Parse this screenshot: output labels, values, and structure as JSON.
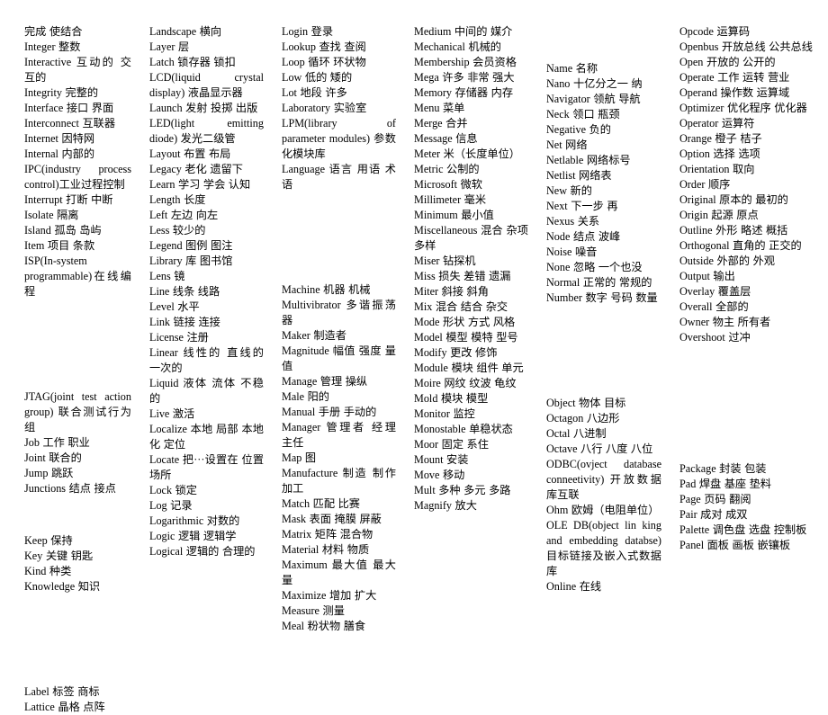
{
  "document": {
    "type": "bilingual-glossary",
    "page_background": "#ffffff",
    "text_color": "#000000",
    "column_count": 6
  },
  "columns": [
    {
      "name": "column-1",
      "entries": [
        {
          "text": "完成 使结合",
          "blank": false
        },
        {
          "text": "Integer 整数",
          "blank": false
        },
        {
          "text": "Interactive 互动的 交互的",
          "blank": false
        },
        {
          "text": "Integrity 完整的",
          "blank": false
        },
        {
          "text": "Interface 接口 界面",
          "blank": false
        },
        {
          "text": "Interconnect 互联器",
          "blank": false
        },
        {
          "text": "Internet 因特网",
          "blank": false
        },
        {
          "text": "Internal 内部的",
          "blank": false
        },
        {
          "text": "IPC(industry process control)工业过程控制",
          "blank": false
        },
        {
          "text": "Interrupt 打断 中断",
          "blank": false
        },
        {
          "text": "Isolate 隔离",
          "blank": false
        },
        {
          "text": "Island 孤岛 岛屿",
          "blank": false
        },
        {
          "text": "Item 项目 条款",
          "blank": false
        },
        {
          "text": "ISP(In-system programmable)在线编程",
          "blank": false
        },
        {
          "text": "",
          "blank": true
        },
        {
          "text": "",
          "blank": true
        },
        {
          "text": "",
          "blank": true
        },
        {
          "text": "JTAG(joint test action group) 联合测试行为组",
          "blank": false
        },
        {
          "text": "Job 工作 职业",
          "blank": false
        },
        {
          "text": "Joint 联合的",
          "blank": false
        },
        {
          "text": "Jump 跳跃",
          "blank": false
        },
        {
          "text": "Junctions 结点 接点",
          "blank": false
        },
        {
          "text": "",
          "blank": true
        },
        {
          "text": "Keep 保持",
          "blank": false
        },
        {
          "text": "Key 关键 钥匙",
          "blank": false
        },
        {
          "text": "Kind 种类",
          "blank": false
        },
        {
          "text": "Knowledge 知识",
          "blank": false
        },
        {
          "text": "",
          "blank": true
        },
        {
          "text": "",
          "blank": true
        },
        {
          "text": "",
          "blank": true
        },
        {
          "text": "Label 标签 商标",
          "blank": false
        },
        {
          "text": "Lattice 晶格 点阵",
          "blank": false
        }
      ]
    },
    {
      "name": "column-2",
      "entries": [
        {
          "text": "Landscape 横向",
          "blank": false
        },
        {
          "text": "Layer 层",
          "blank": false
        },
        {
          "text": "Latch 锁存器 锁扣",
          "blank": false
        },
        {
          "text": "LCD(liquid crystal display) 液晶显示器",
          "blank": false
        },
        {
          "text": "Launch 发射 投掷 出版",
          "blank": false
        },
        {
          "text": "LED(light emitting diode) 发光二级管",
          "blank": false
        },
        {
          "text": "Layout 布置 布局",
          "blank": false
        },
        {
          "text": "Legacy 老化 遗留下",
          "blank": false
        },
        {
          "text": "Learn 学习 学会 认知",
          "blank": false
        },
        {
          "text": "Length 长度",
          "blank": false
        },
        {
          "text": "Left 左边 向左",
          "blank": false
        },
        {
          "text": "Less 较少的",
          "blank": false
        },
        {
          "text": "Legend 图例 图注",
          "blank": false
        },
        {
          "text": "Library 库 图书馆",
          "blank": false
        },
        {
          "text": "Lens 镜",
          "blank": false
        },
        {
          "text": "Line 线条 线路",
          "blank": false
        },
        {
          "text": "Level 水平",
          "blank": false
        },
        {
          "text": "Link 链接 连接",
          "blank": false
        },
        {
          "text": "License 注册",
          "blank": false
        },
        {
          "text": "Linear 线性的 直线的 一次的",
          "blank": false
        },
        {
          "text": "Liquid 液体 流体 不稳的",
          "blank": false
        },
        {
          "text": "Live 激活",
          "blank": false
        },
        {
          "text": "Localize 本地 局部 本地化 定位",
          "blank": false
        },
        {
          "text": "Locate 把···设置在 位置 场所",
          "blank": false
        },
        {
          "text": "Lock 锁定",
          "blank": false
        },
        {
          "text": "Log 记录",
          "blank": false
        },
        {
          "text": "Logarithmic 对数的",
          "blank": false
        },
        {
          "text": "Logic 逻辑 逻辑学",
          "blank": false
        },
        {
          "text": "Logical 逻辑的 合理的",
          "blank": false
        }
      ]
    },
    {
      "name": "column-3",
      "entries": [
        {
          "text": "Login 登录",
          "blank": false
        },
        {
          "text": "Lookup 查找 查阅",
          "blank": false
        },
        {
          "text": "Loop 循环 环状物",
          "blank": false
        },
        {
          "text": "Low 低的 矮的",
          "blank": false
        },
        {
          "text": "Lot 地段 许多",
          "blank": false
        },
        {
          "text": "Laboratory 实验室",
          "blank": false
        },
        {
          "text": "LPM(library of parameter modules) 参数化模块库",
          "blank": false
        },
        {
          "text": "Language 语言 用语 术语",
          "blank": false
        },
        {
          "text": "",
          "blank": true
        },
        {
          "text": "",
          "blank": true
        },
        {
          "text": "",
          "blank": true
        },
        {
          "text": "Machine 机器 机械",
          "blank": false
        },
        {
          "text": "Multivibrator 多谐振荡器",
          "blank": false
        },
        {
          "text": "Maker 制造者",
          "blank": false
        },
        {
          "text": "Magnitude 幅值 强度 量值",
          "blank": false
        },
        {
          "text": "Manage 管理 操纵",
          "blank": false
        },
        {
          "text": "Male 阳的",
          "blank": false
        },
        {
          "text": "Manual 手册 手动的",
          "blank": false
        },
        {
          "text": "Manager 管理者 经理 主任",
          "blank": false
        },
        {
          "text": "Map 图",
          "blank": false
        },
        {
          "text": "Manufacture 制造 制作 加工",
          "blank": false
        },
        {
          "text": "Match 匹配 比赛",
          "blank": false
        },
        {
          "text": "Mask 表面 掩膜 屏蔽",
          "blank": false
        },
        {
          "text": "Matrix 矩阵 混合物",
          "blank": false
        },
        {
          "text": "Material 材料 物质",
          "blank": false
        },
        {
          "text": "Maximum 最大值 最大量",
          "blank": false
        },
        {
          "text": "Maximize 增加 扩大",
          "blank": false
        },
        {
          "text": "Measure 测量",
          "blank": false
        },
        {
          "text": "Meal 粉状物 膳食",
          "blank": false
        }
      ]
    },
    {
      "name": "column-4",
      "entries": [
        {
          "text": "Medium 中间的 媒介",
          "blank": false
        },
        {
          "text": "Mechanical 机械的",
          "blank": false
        },
        {
          "text": "Membership 会员资格",
          "blank": false
        },
        {
          "text": "Mega 许多 非常 强大",
          "blank": false
        },
        {
          "text": "Memory 存储器 内存",
          "blank": false
        },
        {
          "text": "Menu 菜单",
          "blank": false
        },
        {
          "text": "Merge 合并",
          "blank": false
        },
        {
          "text": "Message 信息",
          "blank": false
        },
        {
          "text": "Meter 米（长度单位）",
          "blank": false
        },
        {
          "text": "Metric 公制的",
          "blank": false
        },
        {
          "text": "Microsoft 微软",
          "blank": false
        },
        {
          "text": "Millimeter 毫米",
          "blank": false
        },
        {
          "text": "Minimum 最小值",
          "blank": false
        },
        {
          "text": "Miscellaneous 混合 杂项 多样",
          "blank": false
        },
        {
          "text": "Miser 钻探机",
          "blank": false
        },
        {
          "text": "Miss 损失 差错 遗漏",
          "blank": false
        },
        {
          "text": "Miter 斜接 斜角",
          "blank": false
        },
        {
          "text": "Mix 混合 结合 杂交",
          "blank": false
        },
        {
          "text": "Mode 形状 方式 风格",
          "blank": false
        },
        {
          "text": "Model 模型 模特 型号",
          "blank": false
        },
        {
          "text": "Modify 更改 修饰",
          "blank": false
        },
        {
          "text": "Module 模块 组件 单元",
          "blank": false
        },
        {
          "text": "Moire 网纹 纹波 龟纹",
          "blank": false
        },
        {
          "text": "Mold 模块 模型",
          "blank": false
        },
        {
          "text": "Monitor 监控",
          "blank": false
        },
        {
          "text": "Monostable 单稳状态",
          "blank": false
        },
        {
          "text": "Moor 固定 系住",
          "blank": false
        },
        {
          "text": "Mount 安装",
          "blank": false
        },
        {
          "text": "Move 移动",
          "blank": false
        },
        {
          "text": "Mult 多种 多元 多路",
          "blank": false
        },
        {
          "text": "Magnify 放大",
          "blank": false
        }
      ]
    },
    {
      "name": "column-5",
      "entries": [
        {
          "text": "",
          "blank": true
        },
        {
          "text": "Name 名称",
          "blank": false
        },
        {
          "text": "Nano 十亿分之一 纳",
          "blank": false
        },
        {
          "text": "Navigator 领航 导航",
          "blank": false
        },
        {
          "text": "Neck 领口 瓶颈",
          "blank": false
        },
        {
          "text": "Negative 负的",
          "blank": false
        },
        {
          "text": "Net 网络",
          "blank": false
        },
        {
          "text": "Netlable 网络标号",
          "blank": false
        },
        {
          "text": "Netlist 网络表",
          "blank": false
        },
        {
          "text": "New 新的",
          "blank": false
        },
        {
          "text": "Next 下一步 再",
          "blank": false
        },
        {
          "text": "Nexus 关系",
          "blank": false
        },
        {
          "text": "Node 结点 波峰",
          "blank": false
        },
        {
          "text": "Noise 噪音",
          "blank": false
        },
        {
          "text": "None 忽略 一个也没",
          "blank": false
        },
        {
          "text": "Normal 正常的 常规的",
          "blank": false
        },
        {
          "text": "Number 数字 号码 数量",
          "blank": false
        },
        {
          "text": "",
          "blank": true
        },
        {
          "text": "",
          "blank": true
        },
        {
          "text": "",
          "blank": true
        },
        {
          "text": "Object 物体 目标",
          "blank": false
        },
        {
          "text": "Octagon 八边形",
          "blank": false
        },
        {
          "text": "Octal 八进制",
          "blank": false
        },
        {
          "text": "Octave 八行 八度 八位",
          "blank": false
        },
        {
          "text": "ODBC(ovject database conneetivity) 开放数据库互联",
          "blank": false
        },
        {
          "text": "Ohm 欧姆（电阻单位）",
          "blank": false
        },
        {
          "text": "OLE DB(object lin king and embedding databse) 目标链接及嵌入式数据库",
          "blank": false
        },
        {
          "text": "Online 在线",
          "blank": false
        }
      ]
    },
    {
      "name": "column-6",
      "entries": [
        {
          "text": "Opcode 运算码",
          "blank": false
        },
        {
          "text": "Openbus 开放总线 公共总线",
          "blank": false
        },
        {
          "text": "Open 开放的 公开的",
          "blank": false
        },
        {
          "text": "Operate 工作 运转 营业",
          "blank": false
        },
        {
          "text": "Operand 操作数 运算域",
          "blank": false
        },
        {
          "text": "Optimizer 优化程序 优化器",
          "blank": false
        },
        {
          "text": "Operator 运算符",
          "blank": false
        },
        {
          "text": "Orange 橙子 桔子",
          "blank": false
        },
        {
          "text": "Option 选择 选项",
          "blank": false
        },
        {
          "text": "Orientation 取向",
          "blank": false
        },
        {
          "text": "Order 顺序",
          "blank": false
        },
        {
          "text": "Original 原本的 最初的",
          "blank": false
        },
        {
          "text": "Origin 起源 原点",
          "blank": false
        },
        {
          "text": "Outline 外形 略述 概括",
          "blank": false
        },
        {
          "text": "Orthogonal 直角的 正交的",
          "blank": false
        },
        {
          "text": "Outside 外部的 外观",
          "blank": false
        },
        {
          "text": "Output 输出",
          "blank": false
        },
        {
          "text": "Overlay 覆盖层",
          "blank": false
        },
        {
          "text": "Overall 全部的",
          "blank": false
        },
        {
          "text": "Owner 物主 所有者",
          "blank": false
        },
        {
          "text": "Overshoot 过冲",
          "blank": false
        },
        {
          "text": "",
          "blank": true
        },
        {
          "text": "",
          "blank": true
        },
        {
          "text": "",
          "blank": true
        },
        {
          "text": "",
          "blank": true
        },
        {
          "text": "Package 封装 包装",
          "blank": false
        },
        {
          "text": "Pad 焊盘 基座 垫料",
          "blank": false
        },
        {
          "text": "Page 页码 翻阅",
          "blank": false
        },
        {
          "text": "Pair 成对 成双",
          "blank": false
        },
        {
          "text": "Palette 调色盘 选盘 控制板",
          "blank": false
        },
        {
          "text": "Panel 面板 画板 嵌镶板",
          "blank": false
        }
      ]
    }
  ]
}
